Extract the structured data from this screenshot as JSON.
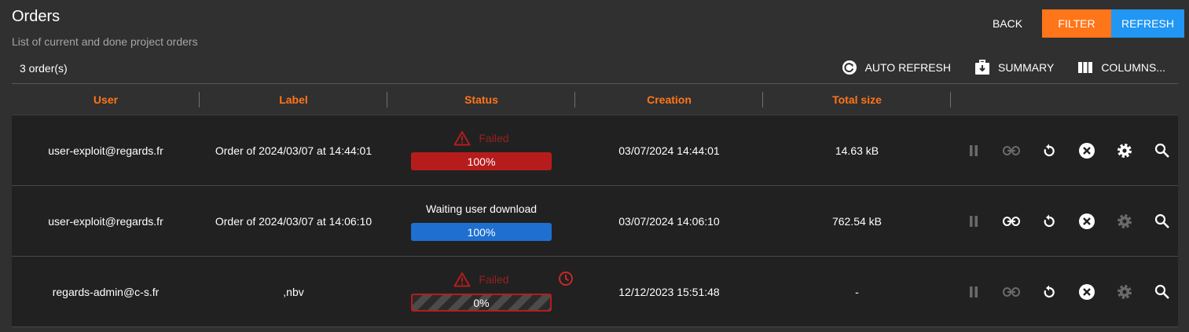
{
  "header": {
    "title": "Orders",
    "subtitle": "List of current and done project orders",
    "back_label": "BACK",
    "filter_label": "FILTER",
    "refresh_label": "REFRESH"
  },
  "toolbar": {
    "count": "3 order(s)",
    "auto_refresh_label": "AUTO REFRESH",
    "summary_label": "SUMMARY",
    "columns_label": "COLUMNS..."
  },
  "colors": {
    "accent": "#ff7519",
    "primary": "#2196f3",
    "error": "#b71c1c"
  },
  "table": {
    "columns": [
      "User",
      "Label",
      "Status",
      "Creation",
      "Total size"
    ],
    "rows": [
      {
        "user": "user-exploit@regards.fr",
        "label": "Order of 2024/03/07 at 14:44:01",
        "status": "Failed",
        "progress_text": "100%",
        "progress": 1.0,
        "creation": "03/07/2024 14:44:01",
        "size": "14.63 kB"
      },
      {
        "user": "user-exploit@regards.fr",
        "label": "Order of 2024/03/07 at 14:06:10",
        "status": "Waiting user download",
        "progress_text": "100%",
        "progress": 1.0,
        "creation": "03/07/2024 14:06:10",
        "size": "762.54 kB"
      },
      {
        "user": "regards-admin@c-s.fr",
        "label": ",nbv",
        "status": "Failed",
        "progress_text": "0%",
        "progress": 0.0,
        "creation": "12/12/2023 15:51:48",
        "size": "-"
      }
    ],
    "row_actions": [
      "pause-icon",
      "link-icon",
      "restart-icon",
      "cancel-icon",
      "settings-icon",
      "search-icon"
    ]
  }
}
